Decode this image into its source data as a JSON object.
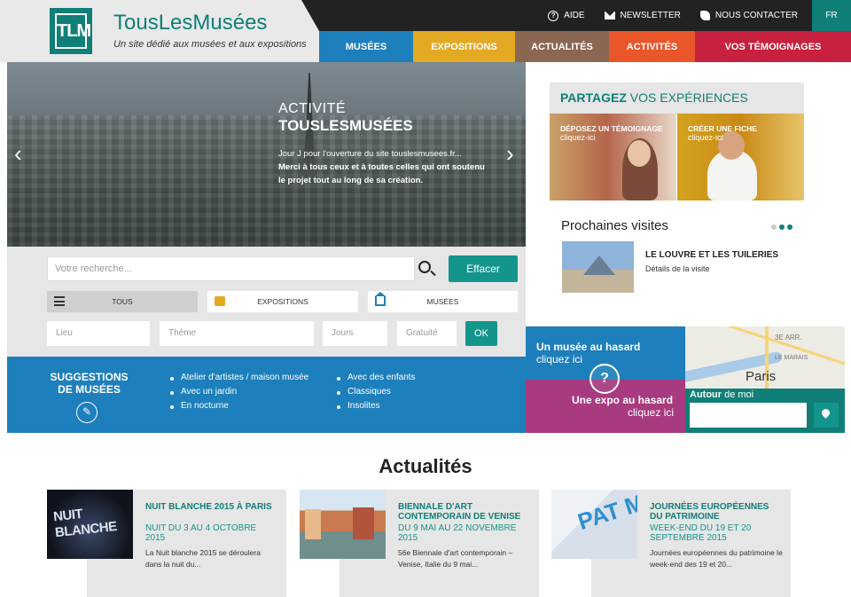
{
  "header": {
    "logo_text": "TLM",
    "site_name": "TousLesMusées",
    "tagline": "Un site dédié aux musées et aux expositions",
    "top_links": [
      {
        "label": "AIDE",
        "icon": "help-icon"
      },
      {
        "label": "NEWSLETTER",
        "icon": "envelope-icon"
      },
      {
        "label": "NOUS CONTACTER",
        "icon": "phone-icon"
      }
    ],
    "lang": "FR"
  },
  "nav": {
    "items": [
      {
        "label": "MUSÉES",
        "color": "#1d7fbb"
      },
      {
        "label": "EXPOSITIONS",
        "color": "#e4a923"
      },
      {
        "label": "ACTUALITÉS",
        "color": "#8a6752"
      },
      {
        "label": "ACTIVITÉS",
        "color": "#e8562a"
      },
      {
        "label": "VOS TÉMOIGNAGES",
        "color": "#c8203f"
      }
    ]
  },
  "hero": {
    "label": "ACTIVITÉ",
    "title": "TOUSLESMUSÉES",
    "desc_line1": "Jour J pour l'ouverture du site touslesmusees.fr...",
    "desc_line2": "Merci à tous ceux et à toutes celles qui ont soutenu le projet tout au long de sa création."
  },
  "search": {
    "placeholder": "Votre recherche...",
    "clear_label": "Effacer",
    "tabs": [
      "TOUS",
      "EXPOSITIONS",
      "MUSÉES"
    ],
    "fields": [
      "Lieu",
      "Thème",
      "Jours",
      "Gratuité"
    ],
    "ok_label": "OK"
  },
  "suggestions": {
    "title": "SUGGESTIONS DE MUSÉES",
    "col1": [
      "Atelier d'artistes / maison musée",
      "Avec un jardin",
      "En nocturne"
    ],
    "col2": [
      "Avec des enfants",
      "Classiques",
      "Insolites"
    ]
  },
  "share": {
    "title_bold": "PARTAGEZ",
    "title_rest": " VOS EXPÉRIENCES",
    "cards": [
      {
        "title": "DÉPOSEZ UN TÉMOIGNAGE",
        "sub": "cliquez-ici"
      },
      {
        "title": "CRÉER UNE FICHE",
        "sub": "cliquez-ici"
      }
    ]
  },
  "visits": {
    "heading": "Prochaines visites",
    "title": "LE LOUVRE ET LES TUILERIES",
    "link": "Détails de la visite"
  },
  "random": {
    "museum_title": "Un musée au hasard",
    "museum_sub": "cliquez ici",
    "expo_title": "Une expo au hasard",
    "expo_sub": "cliquez ici",
    "q": "?"
  },
  "map": {
    "labels": [
      "3E ARR.",
      "LE MARAIS",
      "Paris"
    ]
  },
  "autour": {
    "label_bold": "Autour",
    "label_rest": " de moi"
  },
  "news": {
    "heading": "Actualités",
    "items": [
      {
        "title": "NUIT BLANCHE 2015 À PARIS",
        "date": "NUIT DU 3 AU 4 OCTOBRE 2015",
        "desc": "La Nuit blanche 2015  se déroulera dans la nuit du..."
      },
      {
        "title": "BIENNALE D'ART CONTEMPORAIN DE VENISE",
        "date": "DU 9 MAI AU 22 NOVEMBRE 2015",
        "desc": "56e Biennale d'art contemporain – Venise, Italie du 9 mai..."
      },
      {
        "title": "JOURNÉES EUROPÉENNES DU PATRIMOINE",
        "date": "WEEK-END DU 19 ET 20 SEPTEMBRE 2015",
        "desc": "Journées européennes du patrimoine le week-end des 19 et 20..."
      }
    ],
    "img_texts": [
      "NUIT BLANCHE",
      "PAT MOI"
    ]
  }
}
